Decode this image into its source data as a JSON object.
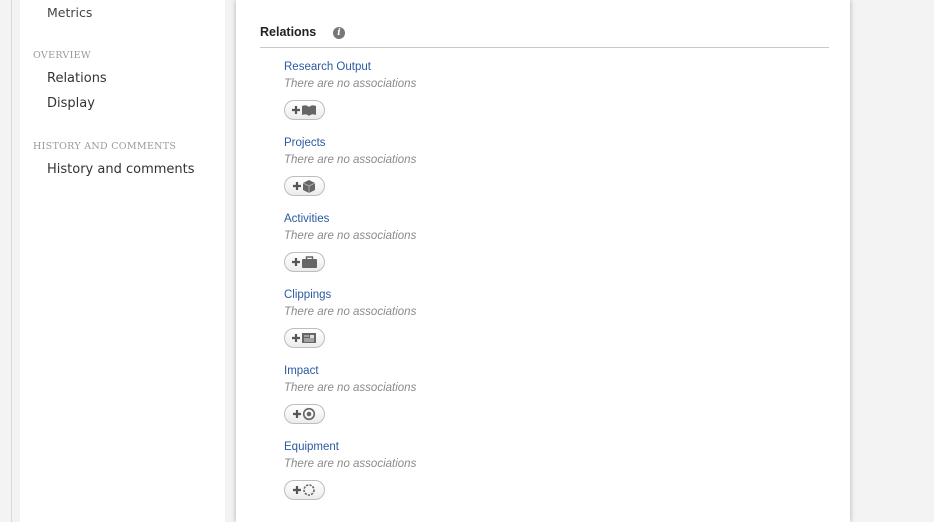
{
  "sidebar": {
    "items_top": [
      "Metrics"
    ],
    "sections": [
      {
        "title": "OVERVIEW",
        "items": [
          "Relations",
          "Display"
        ]
      },
      {
        "title": "HISTORY AND COMMENTS",
        "items": [
          "History and comments"
        ]
      }
    ]
  },
  "relations": {
    "title": "Relations",
    "info_icon": "i",
    "groups": [
      {
        "label": "Research Output",
        "empty_text": "There are no associations",
        "icon": "book-icon"
      },
      {
        "label": "Projects",
        "empty_text": "There are no associations",
        "icon": "cube-icon"
      },
      {
        "label": "Activities",
        "empty_text": "There are no associations",
        "icon": "briefcase-icon"
      },
      {
        "label": "Clippings",
        "empty_text": "There are no associations",
        "icon": "newspaper-icon"
      },
      {
        "label": "Impact",
        "empty_text": "There are no associations",
        "icon": "target-icon"
      },
      {
        "label": "Equipment",
        "empty_text": "There are no associations",
        "icon": "ring-icon"
      }
    ]
  }
}
